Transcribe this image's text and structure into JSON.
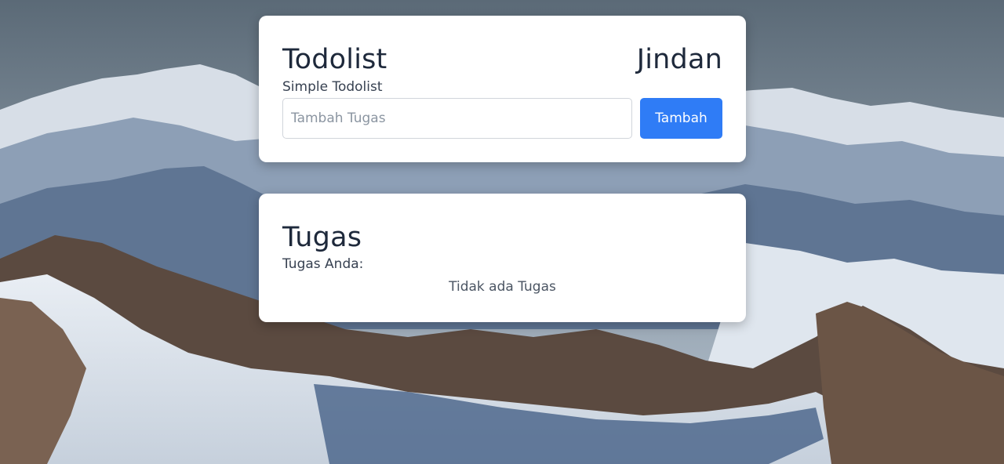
{
  "header_card": {
    "title": "Todolist",
    "user_name": "Jindan",
    "subtitle": "Simple Todolist",
    "input": {
      "value": "",
      "placeholder": "Tambah Tugas"
    },
    "add_button_label": "Tambah"
  },
  "tasks_card": {
    "title": "Tugas",
    "subtitle": "Tugas Anda:",
    "empty_message": "Tidak ada Tugas",
    "tasks": []
  },
  "colors": {
    "accent": "#2f7cf6",
    "card_bg": "#ffffff",
    "text": "#1e293b"
  }
}
